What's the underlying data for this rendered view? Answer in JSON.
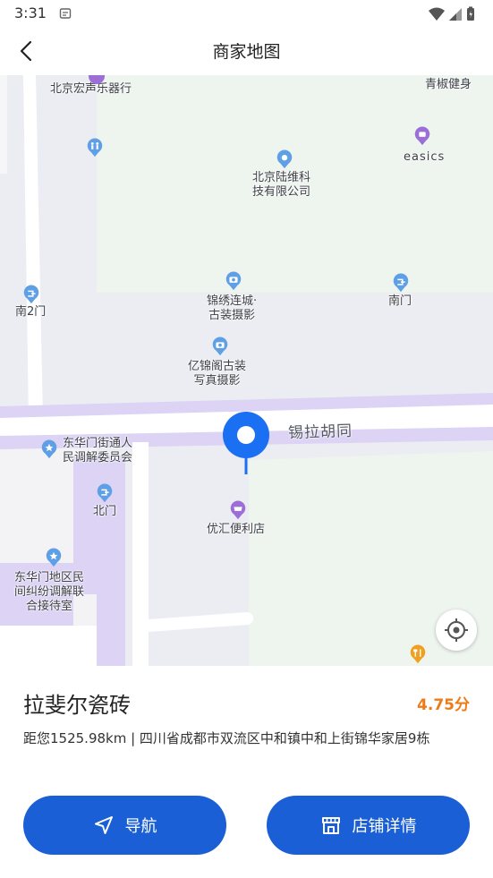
{
  "status_bar": {
    "time": "3:31"
  },
  "header": {
    "title": "商家地图",
    "back_icon": "back-arrow-icon"
  },
  "map": {
    "street": "锡拉胡同",
    "pois": [
      {
        "id": "hongsheng",
        "label": "北京宏声乐器行",
        "icon": "shop-icon"
      },
      {
        "id": "qingjiao",
        "label": "青椒健身",
        "icon": "fitness-icon"
      },
      {
        "id": "toilet",
        "label": "",
        "icon": "toilet-icon"
      },
      {
        "id": "luwei",
        "label": "北京陆维科\n技有限公司",
        "icon": "location-pin-icon"
      },
      {
        "id": "easics",
        "label": "easics",
        "icon": "shopping-icon"
      },
      {
        "id": "nan2men",
        "label": "南2门",
        "icon": "gate-icon"
      },
      {
        "id": "jinxiu",
        "label": "锦绣连城·\n古装摄影",
        "icon": "camera-icon"
      },
      {
        "id": "nanmen",
        "label": "南门",
        "icon": "gate-icon"
      },
      {
        "id": "yijin",
        "label": "亿锦阁古装\n写真摄影",
        "icon": "camera-icon"
      },
      {
        "id": "donghuamen_jd",
        "label": "东华门街通人\n民调解委员会",
        "icon": "government-icon"
      },
      {
        "id": "beimen",
        "label": "北门",
        "icon": "gate-icon"
      },
      {
        "id": "youhui",
        "label": "优汇便利店",
        "icon": "convenience-store-icon"
      },
      {
        "id": "donghuamen_dq",
        "label": "东华门地区民\n间纠纷调解联\n合接待室",
        "icon": "government-icon"
      },
      {
        "id": "restaurant",
        "label": "",
        "icon": "restaurant-icon"
      }
    ],
    "locate_icon": "locate-crosshair-icon",
    "marker_icon": "map-marker-icon"
  },
  "shop": {
    "name": "拉斐尔瓷砖",
    "rating": "4.75分",
    "address": "距您1525.98km | 四川省成都市双流区中和镇中和上街锦华家居9栋"
  },
  "actions": {
    "navigate_label": "导航",
    "navigate_icon": "navigation-arrow-icon",
    "detail_label": "店铺详情",
    "detail_icon": "storefront-icon"
  },
  "colors": {
    "primary": "#1a5fd5",
    "rating": "#f07a15",
    "road_purple": "#dcd3f5",
    "block_green": "#eef5ef",
    "poi_blue": "#5f9fe6",
    "poi_purple": "#9b6fd6"
  }
}
